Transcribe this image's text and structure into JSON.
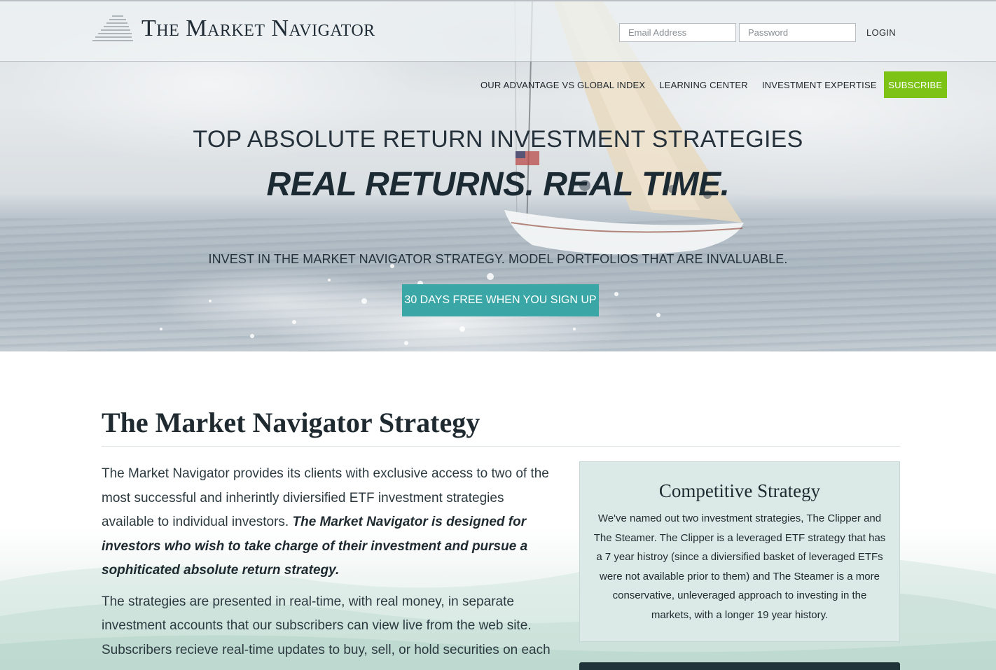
{
  "brand": {
    "name": "The Market Navigator"
  },
  "login": {
    "email_placeholder": "Email Address",
    "password_placeholder": "Password",
    "login_label": "LOGIN"
  },
  "nav": {
    "items": [
      {
        "label": "OUR ADVANTAGE VS GLOBAL INDEX"
      },
      {
        "label": "LEARNING CENTER"
      },
      {
        "label": "INVESTMENT EXPERTISE"
      }
    ],
    "subscribe_label": "SUBSCRIBE"
  },
  "hero": {
    "eyebrow": "TOP ABSOLUTE RETURN INVESTMENT STRATEGIES",
    "title": "REAL RETURNS. REAL TIME.",
    "subtitle": "INVEST IN THE MARKET NAVIGATOR STRATEGY. MODEL PORTFOLIOS THAT ARE INVALUABLE.",
    "cta_label": "30 DAYS FREE WHEN YOU SIGN UP"
  },
  "strategy": {
    "title": "The Market Navigator Strategy",
    "para1_plain": "The Market Navigator provides its clients with exclusive access to two of the most successful and inherintly diviersified ETF investment strategies available to individual investors. ",
    "para1_emph": "The Market Navigator is designed for investors who wish to take charge of their investment and pursue a sophiticated absolute return strategy.",
    "para2": "The strategies are presented in real-time, with real money, in separate investment accounts that our subscribers can view live from the web site. Subscribers recieve real-time updates to buy, sell, or hold securities on each"
  },
  "competitive": {
    "title": "Competitive Strategy",
    "text": "We've named out two investment strategies, The Clipper and The Steamer. The Clipper is a leveraged ETF strategy that has a 7 year histroy (since a diviersified basket of leveraged ETFs were not available prior to them) and The Steamer is a more conservative, unleveraged approach to investing in the markets, with a longer 19 year history."
  },
  "colors": {
    "subscribe_green": "#7dc316",
    "cta_teal": "#3aa6a6",
    "aside_bg": "#dbe9e7"
  }
}
